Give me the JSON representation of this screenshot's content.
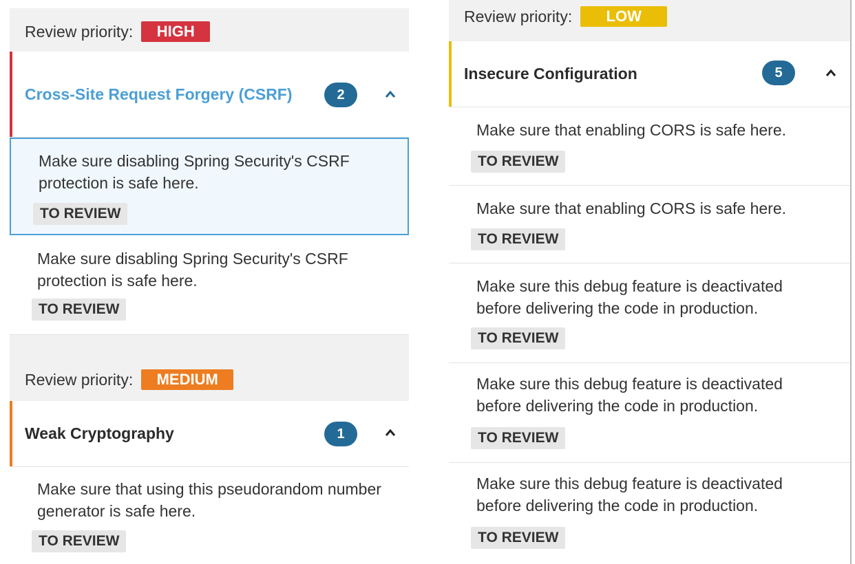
{
  "left": {
    "high": {
      "priority_label": "Review priority:",
      "badge": "HIGH",
      "badge_color": "#d4333f",
      "category": {
        "title": "Cross-Site Request Forgery (CSRF)",
        "title_color": "#4b9fd5",
        "count": "2",
        "accent_color": "#d4333f"
      },
      "hotspots": [
        {
          "message": "Make sure disabling Spring Security's CSRF protection is safe here.",
          "status": "TO REVIEW"
        },
        {
          "message": "Make sure disabling Spring Security's CSRF protection is safe here.",
          "status": "TO REVIEW"
        }
      ]
    },
    "medium": {
      "priority_label": "Review priority:",
      "badge": "MEDIUM",
      "badge_color": "#ed7d20",
      "category": {
        "title": "Weak Cryptography",
        "count": "1",
        "accent_color": "#ed7d20"
      },
      "hotspots": [
        {
          "message": "Make sure that using this pseudorandom number generator is safe here.",
          "status": "TO REVIEW"
        }
      ]
    }
  },
  "right": {
    "low": {
      "priority_label": "Review priority:",
      "badge": "LOW",
      "badge_color": "#eabe06",
      "category": {
        "title": "Insecure Configuration",
        "count": "5",
        "accent_color": "#eabe06"
      },
      "hotspots": [
        {
          "message": "Make sure that enabling CORS is safe here.",
          "status": "TO REVIEW"
        },
        {
          "message": "Make sure that enabling CORS is safe here.",
          "status": "TO REVIEW"
        },
        {
          "message": "Make sure this debug feature is deactivated before delivering the code in production.",
          "status": "TO REVIEW"
        },
        {
          "message": "Make sure this debug feature is deactivated before delivering the code in production.",
          "status": "TO REVIEW"
        },
        {
          "message": "Make sure this debug feature is deactivated before delivering the code in production.",
          "status": "TO REVIEW"
        }
      ]
    }
  },
  "icons": {
    "chevron": "chevron-up-icon"
  },
  "colors": {
    "count_pill": "#236a97",
    "selected_border": "#4b9fd5",
    "panel_bg": "#f1f1f1",
    "status_bg": "#e6e6e6"
  }
}
